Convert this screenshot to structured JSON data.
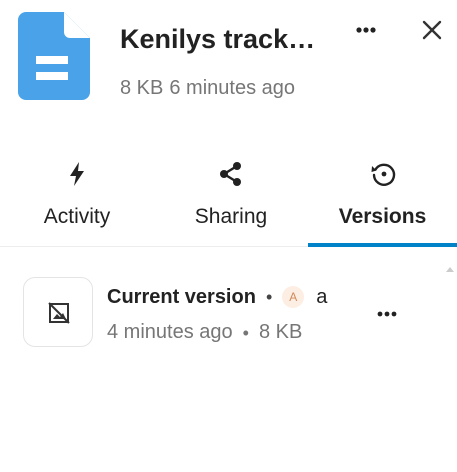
{
  "file": {
    "title": "Kenilys track…",
    "size": "8 KB",
    "modified": "6 minutes ago",
    "icon": "text-document-icon",
    "icon_color": "#4aa3e8"
  },
  "header": {
    "menu_icon": "more-horizontal-icon",
    "close_icon": "close-icon"
  },
  "tabs": [
    {
      "label": "Activity",
      "icon": "lightning-icon",
      "active": false
    },
    {
      "label": "Sharing",
      "icon": "share-icon",
      "active": false
    },
    {
      "label": "Versions",
      "icon": "history-icon",
      "active": true
    }
  ],
  "accent_color": "#0082c9",
  "versions": [
    {
      "title": "Current version",
      "author_initial": "A",
      "author": "a",
      "time": "4 minutes ago",
      "size": "8 KB",
      "thumbnail_icon": "no-preview-icon",
      "menu_icon": "more-horizontal-icon"
    }
  ]
}
